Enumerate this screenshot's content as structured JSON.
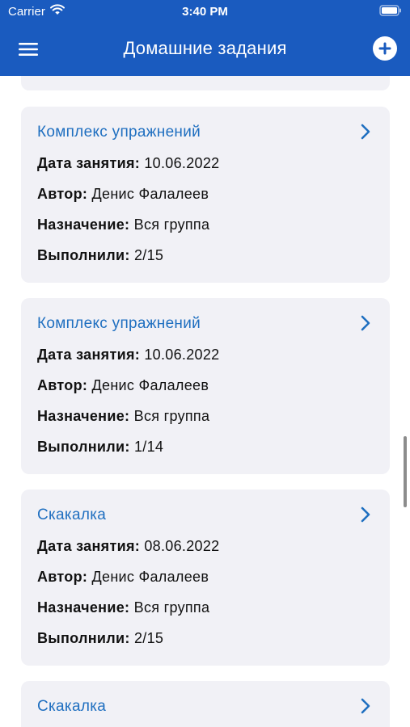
{
  "status_bar": {
    "carrier": "Carrier",
    "time": "3:40 PM"
  },
  "header": {
    "title": "Домашние задания"
  },
  "labels": {
    "date": "Дата занятия:",
    "author": "Автор:",
    "assignment": "Назначение:",
    "completed": "Выполнили:"
  },
  "tasks": [
    {
      "title": "Комплекс упражнений",
      "date": "10.06.2022",
      "author": "Денис Фалалеев",
      "assignment": "Вся группа",
      "completed": "2/15"
    },
    {
      "title": "Комплекс упражнений",
      "date": "10.06.2022",
      "author": "Денис Фалалеев",
      "assignment": "Вся группа",
      "completed": "1/14"
    },
    {
      "title": "Скакалка",
      "date": "08.06.2022",
      "author": "Денис Фалалеев",
      "assignment": "Вся группа",
      "completed": "2/15"
    },
    {
      "title": "Скакалка"
    }
  ],
  "colors": {
    "header": "#1a5bbf",
    "card": "#f1f1f6",
    "link": "#1f6fc0"
  }
}
